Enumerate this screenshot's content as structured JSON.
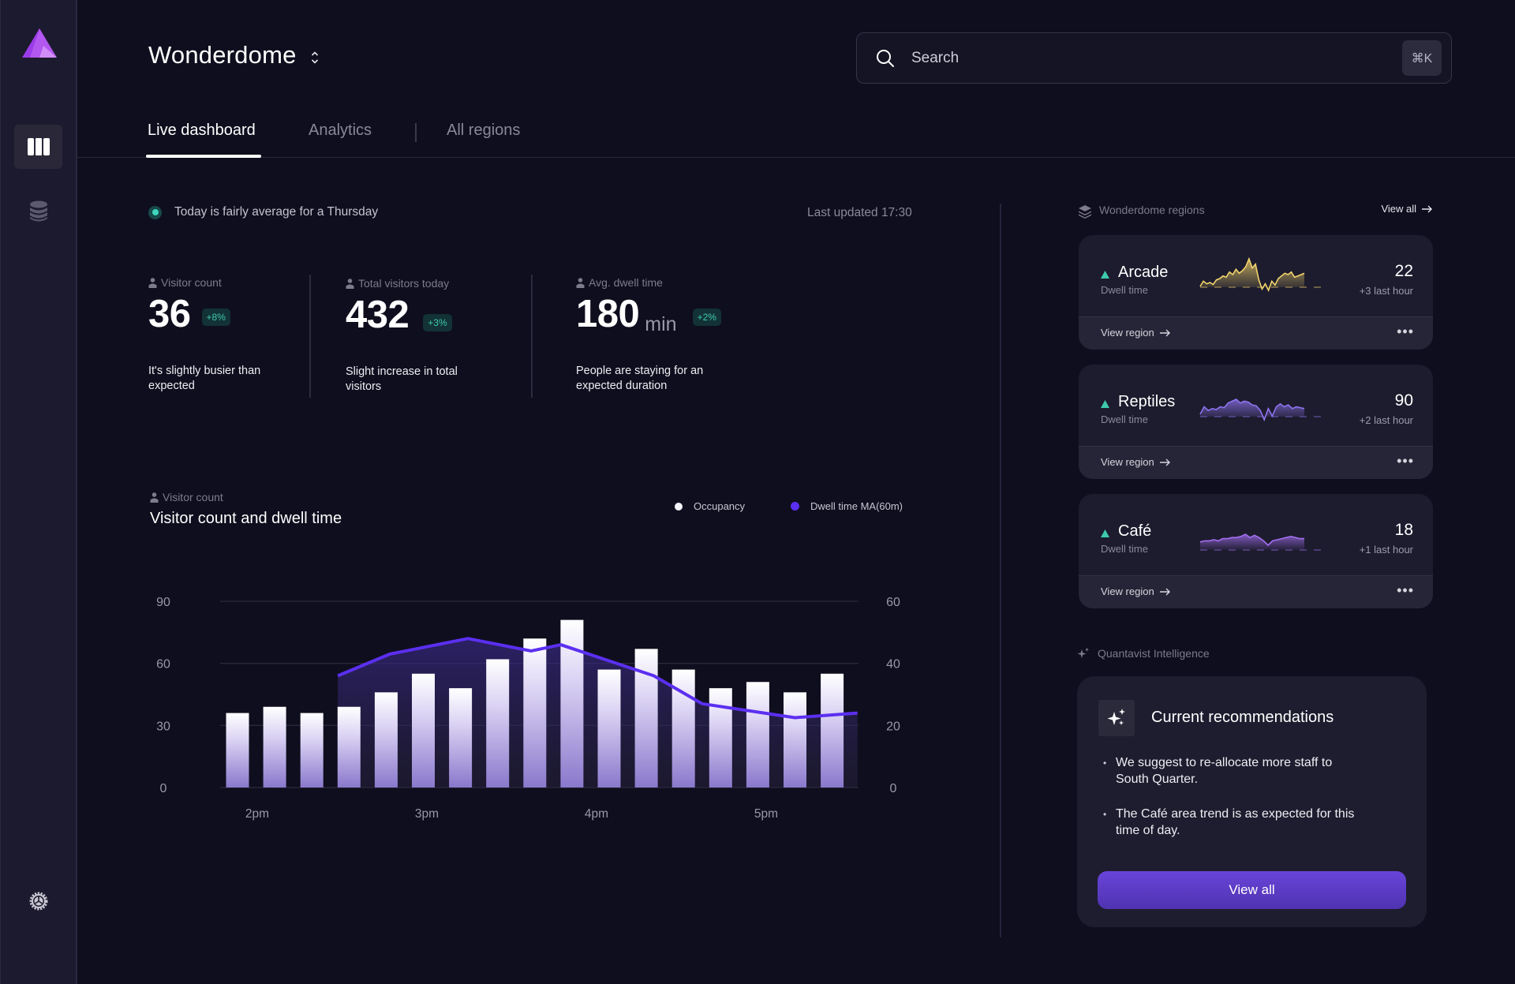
{
  "app": {
    "workspace_name": "Wonderdome",
    "brand_color": "#a855f7"
  },
  "sidebar": {
    "items": [
      {
        "name": "dashboard",
        "icon": "columns-icon",
        "active": true
      },
      {
        "name": "database",
        "icon": "database-icon",
        "active": false
      },
      {
        "name": "settings",
        "icon": "gear-icon",
        "active": false
      }
    ]
  },
  "search": {
    "placeholder": "Search",
    "shortcut": "⌘K"
  },
  "tabs": [
    {
      "label": "Live dashboard",
      "active": true
    },
    {
      "label": "Analytics",
      "active": false
    },
    {
      "label": "All regions",
      "active": false
    }
  ],
  "status": {
    "text": "Today is fairly average for a Thursday",
    "last_updated": "Last updated 17:30",
    "color": "#3ed6bd"
  },
  "stats": [
    {
      "label": "Visitor count",
      "value": "36",
      "unit": "",
      "badge": "+8%",
      "description": "It's slightly busier than expected"
    },
    {
      "label": "Total visitors today",
      "value": "432",
      "unit": "",
      "badge": "+3%",
      "description": "Slight increase in total visitors"
    },
    {
      "label": "Avg. dwell time",
      "value": "180",
      "unit": "min",
      "badge": "+2%",
      "description": "People are staying for an expected duration"
    }
  ],
  "chart_section": {
    "label": "Visitor count",
    "title": "Visitor count and dwell time"
  },
  "chart_data": {
    "type": "bar",
    "title": "Visitor count and dwell time",
    "xlabel": "",
    "ylabel": "",
    "x_tick_labels": [
      "2pm",
      "3pm",
      "4pm",
      "5pm"
    ],
    "y_left": {
      "ticks": [
        0,
        30,
        60,
        90
      ],
      "range": [
        0,
        90
      ]
    },
    "y_right": {
      "ticks": [
        0,
        20,
        40,
        60
      ],
      "range": [
        0,
        60
      ]
    },
    "grid": true,
    "legend_position": "top-right",
    "series": [
      {
        "name": "Occupancy",
        "type": "bar",
        "axis": "left",
        "color": "#ffffff",
        "values": [
          36,
          39,
          36,
          39,
          46,
          55,
          48,
          62,
          72,
          81,
          57,
          67,
          57,
          48,
          51,
          46,
          55
        ]
      },
      {
        "name": "Dwell time MA(60m)",
        "type": "line",
        "axis": "right",
        "color": "#5b2ff0",
        "points": [
          {
            "bar_index": 2.7,
            "value": 36
          },
          {
            "bar_index": 4.1,
            "value": 43
          },
          {
            "bar_index": 6.2,
            "value": 48
          },
          {
            "bar_index": 7.9,
            "value": 44
          },
          {
            "bar_index": 8.7,
            "value": 46
          },
          {
            "bar_index": 11.2,
            "value": 36
          },
          {
            "bar_index": 12.5,
            "value": 27
          },
          {
            "bar_index": 15.0,
            "value": 22.5
          },
          {
            "bar_index": 17.0,
            "value": 24
          }
        ]
      }
    ]
  },
  "regions": {
    "title": "Wonderdome regions",
    "view_all": "View all",
    "cards": [
      {
        "name": "Arcade",
        "sub": "Dwell time",
        "value": "22",
        "delta": "+3 last hour",
        "trend": "up",
        "color": "#f2d46b",
        "spark": [
          10,
          18,
          14,
          16,
          13,
          20,
          22,
          26,
          24,
          32,
          28,
          36,
          30,
          34,
          40,
          52,
          38,
          44,
          20,
          6,
          14,
          4,
          18,
          12,
          22,
          26,
          30,
          28,
          32,
          24,
          26,
          28,
          30
        ]
      },
      {
        "name": "Reptiles",
        "sub": "Dwell time",
        "value": "90",
        "delta": "+2 last hour",
        "trend": "up",
        "color": "#8f74f0",
        "spark": [
          10,
          18,
          14,
          16,
          15,
          18,
          17,
          22,
          24,
          26,
          22,
          24,
          23,
          20,
          19,
          14,
          4,
          16,
          8,
          18,
          21,
          18,
          20,
          16,
          18,
          17,
          16
        ]
      },
      {
        "name": "Café",
        "sub": "Dwell time",
        "value": "18",
        "delta": "+1 last hour",
        "trend": "up",
        "color": "#a46ef0",
        "spark": [
          14,
          15,
          15,
          16,
          15,
          17,
          17,
          18,
          18,
          19,
          21,
          18,
          20,
          18,
          15,
          11,
          15,
          16,
          17,
          18,
          19,
          18,
          17,
          17
        ]
      }
    ],
    "view_region": "View region"
  },
  "intelligence": {
    "label": "Quantavist Intelligence",
    "title": "Current recommendations",
    "items": [
      "We suggest to re-allocate more staff to South Quarter.",
      "The Café area trend is as expected for this time of day."
    ],
    "button": "View all"
  }
}
